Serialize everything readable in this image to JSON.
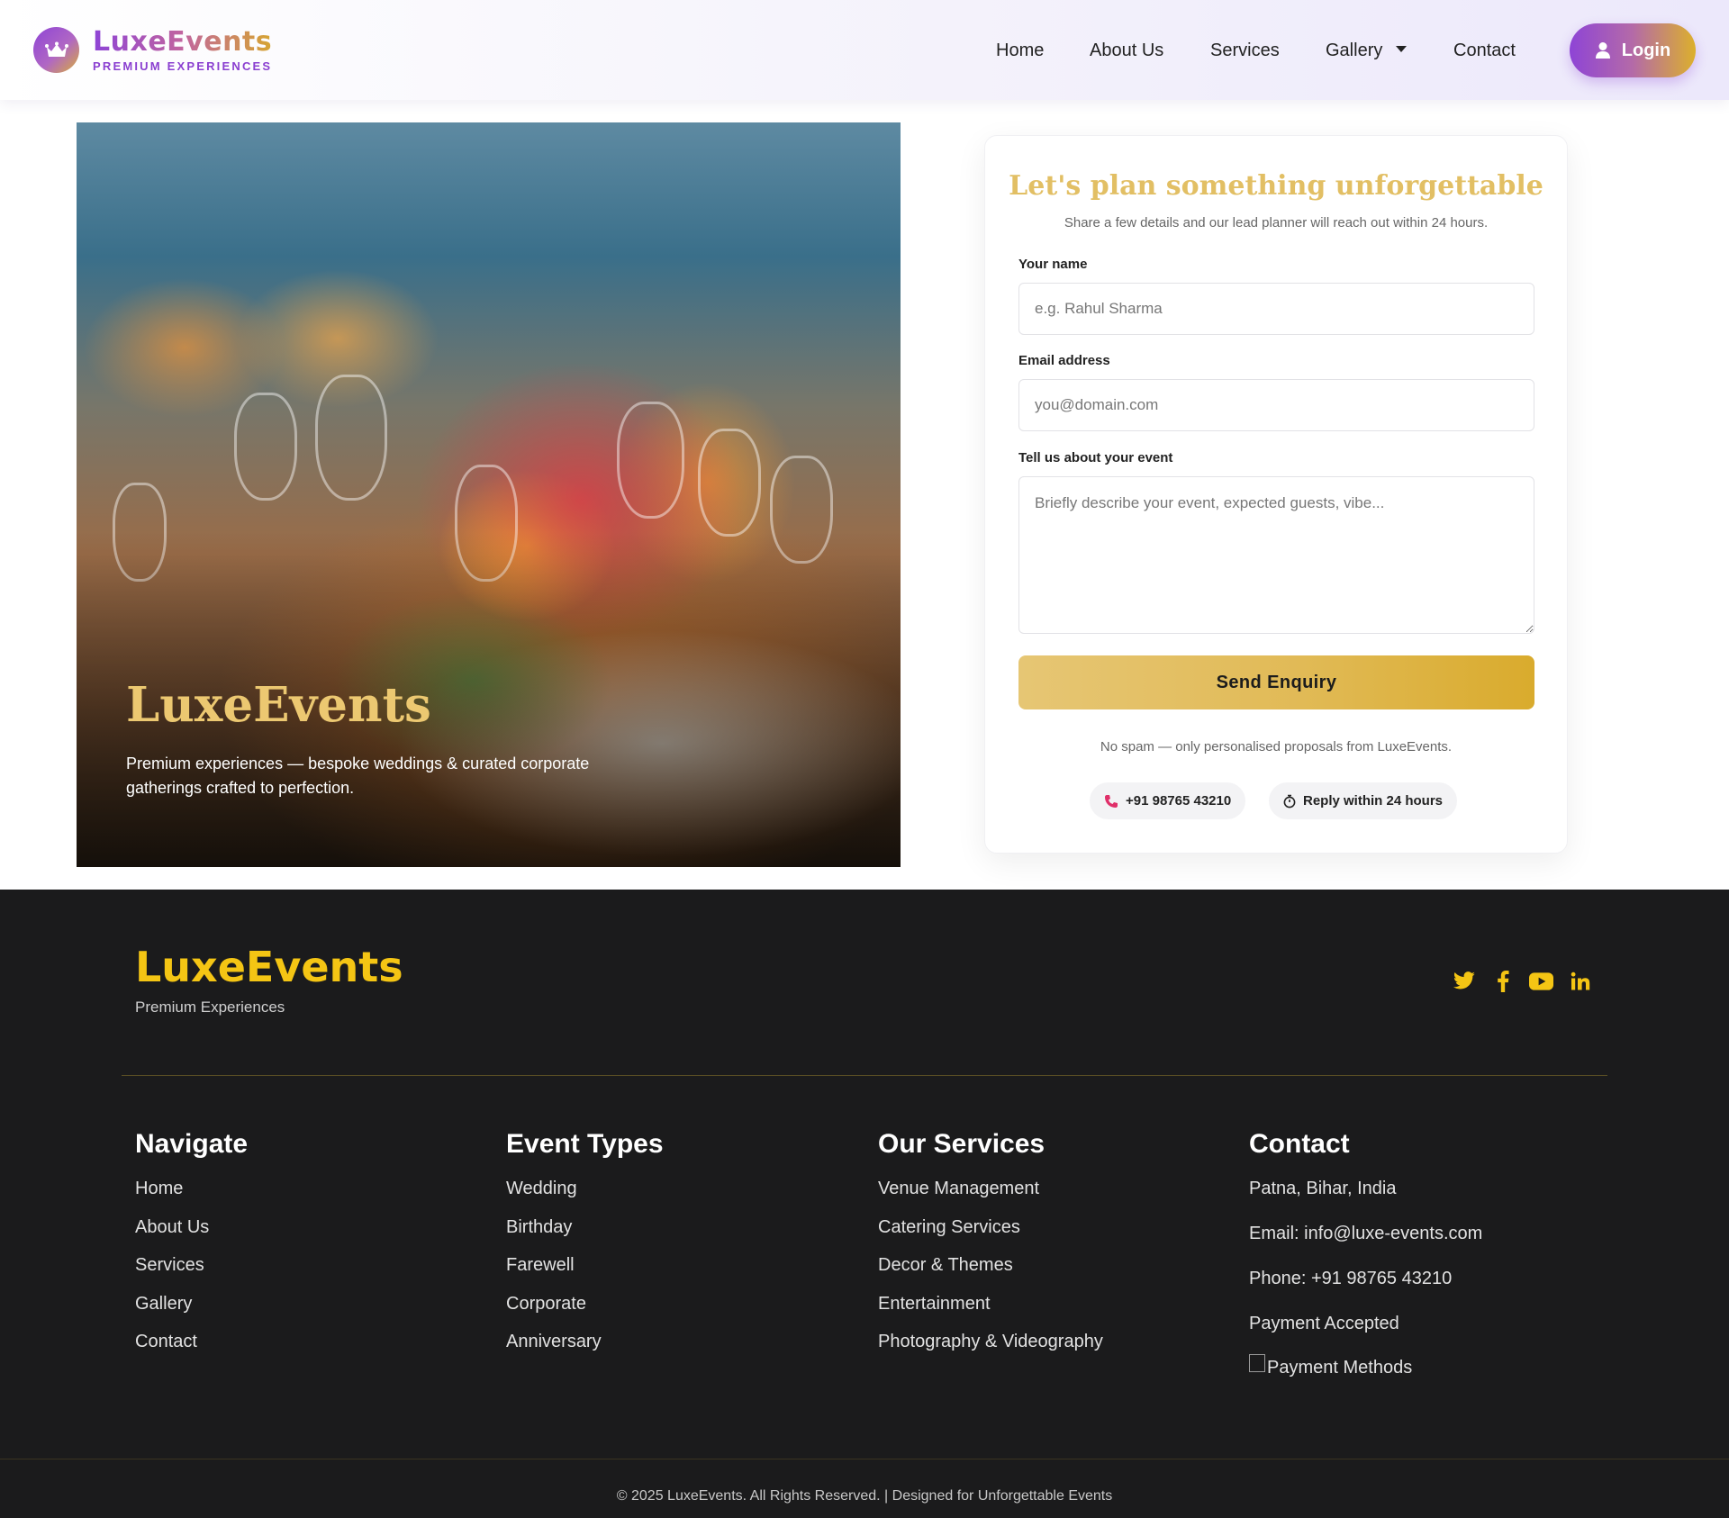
{
  "header": {
    "brand": "LuxeEvents",
    "tagline": "PREMIUM EXPERIENCES",
    "nav": [
      "Home",
      "About Us",
      "Services",
      "Gallery",
      "Contact"
    ],
    "login_label": "Login"
  },
  "hero": {
    "title": "LuxeEvents",
    "text": "Premium experiences — bespoke weddings & curated corporate gatherings crafted to perfection."
  },
  "form": {
    "title": "Let's plan something unforgettable",
    "subtitle": "Share a few details and our lead planner will reach out within 24 hours.",
    "name_label": "Your name",
    "name_placeholder": "e.g. Rahul Sharma",
    "email_label": "Email address",
    "email_placeholder": "you@domain.com",
    "event_label": "Tell us about your event",
    "event_placeholder": "Briefly describe your event, expected guests, vibe...",
    "submit_label": "Send Enquiry",
    "note": "No spam — only personalised proposals from LuxeEvents.",
    "phone_chip": "+91 98765 43210",
    "reply_chip": "Reply within 24 hours"
  },
  "footer": {
    "brand": "LuxeEvents",
    "tagline": "Premium Experiences",
    "socials": [
      "twitter-icon",
      "facebook-icon",
      "youtube-icon",
      "linkedin-icon"
    ],
    "columns": [
      {
        "title": "Navigate",
        "links": [
          "Home",
          "About Us",
          "Services",
          "Gallery",
          "Contact"
        ]
      },
      {
        "title": "Event Types",
        "links": [
          "Wedding",
          "Birthday",
          "Farewell",
          "Corporate",
          "Anniversary"
        ]
      },
      {
        "title": "Our Services",
        "links": [
          "Venue Management",
          "Catering Services",
          "Decor & Themes",
          "Entertainment",
          "Photography & Videography"
        ]
      }
    ],
    "contact": {
      "title": "Contact",
      "address": "Patna, Bihar, India",
      "email": "Email: info@luxe-events.com",
      "phone": "Phone: +91 98765 43210",
      "payment": "Payment Accepted",
      "payment_alt": "Payment Methods"
    },
    "copyright": "© 2025 LuxeEvents. All Rights Reserved. | Designed for Unforgettable Events"
  },
  "colors": {
    "purple": "#8e44d6",
    "gold": "#d9ab2d",
    "footer_gold": "#f4c514",
    "footer_bg": "#1b1b1c"
  }
}
